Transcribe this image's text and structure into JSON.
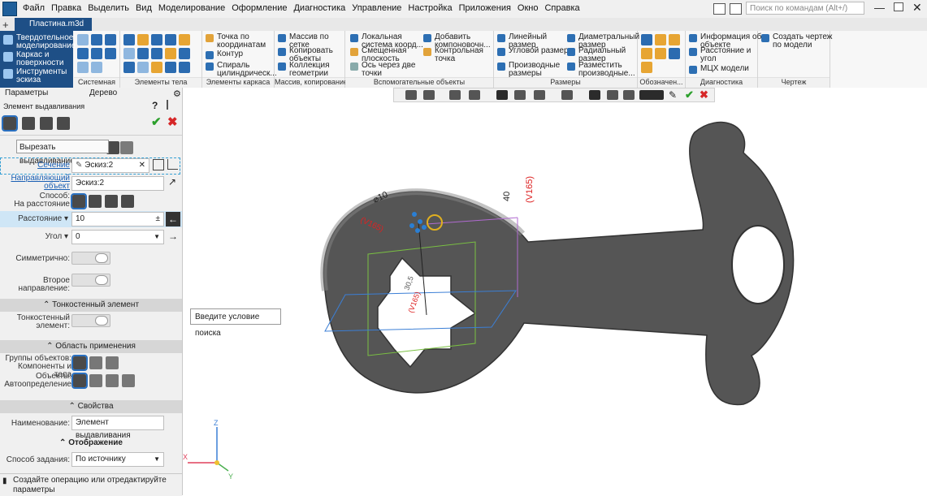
{
  "menu": [
    "Файл",
    "Правка",
    "Выделить",
    "Вид",
    "Моделирование",
    "Оформление",
    "Диагностика",
    "Управление",
    "Настройка",
    "Приложения",
    "Окно",
    "Справка"
  ],
  "search": {
    "placeholder": "Поиск по командам (Alt+/)"
  },
  "document_tab": "Пластина.m3d",
  "modes": [
    "Твердотельное моделирование",
    "Каркас и поверхности",
    "Инструменты эскиза"
  ],
  "ribbon": {
    "groups": [
      {
        "caption": "Системная"
      },
      {
        "caption": "Элементы тела"
      },
      {
        "caption": "Элементы каркаса",
        "items": [
          "Точка по координатам",
          "Контур",
          "Спираль цилиндрическ..."
        ]
      },
      {
        "caption": "Массив, копирование",
        "items": [
          "Массив по сетке",
          "Копировать объекты",
          "Коллекция геометрии"
        ]
      },
      {
        "caption": "Вспомогательные объекты",
        "items": [
          "Локальная система коорд...",
          "Смещенная плоскость",
          "Ось через две точки",
          "Добавить компоновочн...",
          "Контрольная точка"
        ]
      },
      {
        "caption": "Размеры",
        "items": [
          "Линейный размер",
          "Угловой размер",
          "Производные размеры",
          "Диаметральный размер",
          "Радиальный размер",
          "Разместить производные..."
        ]
      },
      {
        "caption": "Обозначен..."
      },
      {
        "caption": "Диагностика",
        "items": [
          "Информация об объекте",
          "Расстояние и угол",
          "МЦХ модели"
        ]
      },
      {
        "caption": "Чертеж",
        "items": [
          "Создать чертеж по модели"
        ]
      }
    ]
  },
  "panel": {
    "tabs": [
      "Параметры",
      "Дерево"
    ],
    "title": "Элемент выдавливания",
    "tooltip": "Вырезать выдавливанием",
    "section_label": "Сечение",
    "section_value": "Эскиз:2",
    "guide_label": "Направляющий объект",
    "guide_value": "Эскиз:2",
    "method_label": "Способ:",
    "method_value": "На расстояние",
    "distance_label": "Расстояние",
    "distance_value": "10",
    "angle_label": "Угол",
    "angle_value": "0",
    "symmetric_label": "Симметрично:",
    "second_dir_label": "Второе направление:",
    "thin_section": "Тонкостенный элемент",
    "thin_label": "Тонкостенный элемент:",
    "scope_section": "Область применения",
    "groups_label": "Группы объектов: Компоненты и тела",
    "objects_label": "Объекты: Автоопределение",
    "props_section": "Свойства",
    "name_label": "Наименование:",
    "name_value": "Элемент выдавливания",
    "display_section": "Отображение",
    "mode_label": "Способ задания:",
    "mode_value": "По источнику"
  },
  "viewport": {
    "search_hint": "Введите условие поиска",
    "dim_labels": [
      "⌀10",
      "40",
      "(V165)",
      "(V165)",
      "30,5",
      "(V165)"
    ],
    "axes": [
      "Z",
      "X",
      "Y"
    ]
  },
  "status": "Создайте операцию или отредактируйте параметры"
}
